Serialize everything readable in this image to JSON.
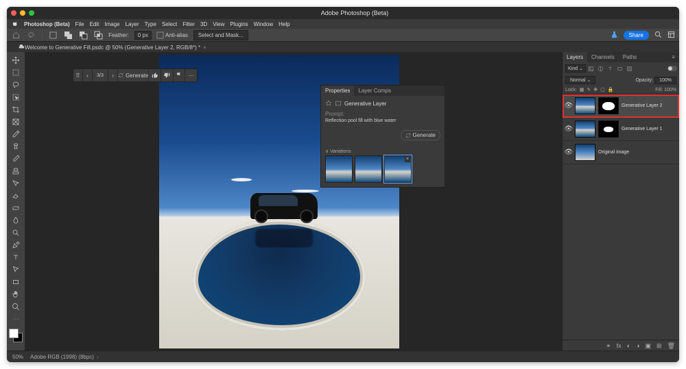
{
  "app": {
    "title": "Adobe Photoshop (Beta)",
    "name": "Photoshop (Beta)"
  },
  "menu": [
    "File",
    "Edit",
    "Image",
    "Layer",
    "Type",
    "Select",
    "Filter",
    "3D",
    "View",
    "Plugins",
    "Window",
    "Help"
  ],
  "optbar": {
    "feather_label": "Feather:",
    "feather_value": "0 px",
    "anti_alias": "Anti-alias",
    "select_mask": "Select and Mask..."
  },
  "share": "Share",
  "doc_tab": "Welcome to Generative Fill.psdc @ 50% (Generative Layer 2, RGB/8*) *",
  "status": {
    "zoom": "50%",
    "profile": "Adobe RGB (1998) (8bpc)"
  },
  "ctx": {
    "counter": "3/3",
    "generate": "Generate"
  },
  "properties": {
    "tab1": "Properties",
    "tab2": "Layer Comps",
    "layer_type": "Generative Layer",
    "prompt_label": "Prompt:",
    "prompt_value": "Reflection pool fill with blue water",
    "generate": "Generate",
    "variations_label": "Variations"
  },
  "layers_panel": {
    "tab1": "Layers",
    "tab2": "Channels",
    "tab3": "Paths",
    "kind": "Kind",
    "blend": "Normal",
    "opacity_label": "Opacity:",
    "opacity": "100%",
    "lock_label": "Lock:",
    "fill_label": "Fill:",
    "fill": "100%",
    "layers": [
      {
        "name": "Generative Layer 2"
      },
      {
        "name": "Generative Layer 1"
      },
      {
        "name": "Original image"
      }
    ]
  }
}
